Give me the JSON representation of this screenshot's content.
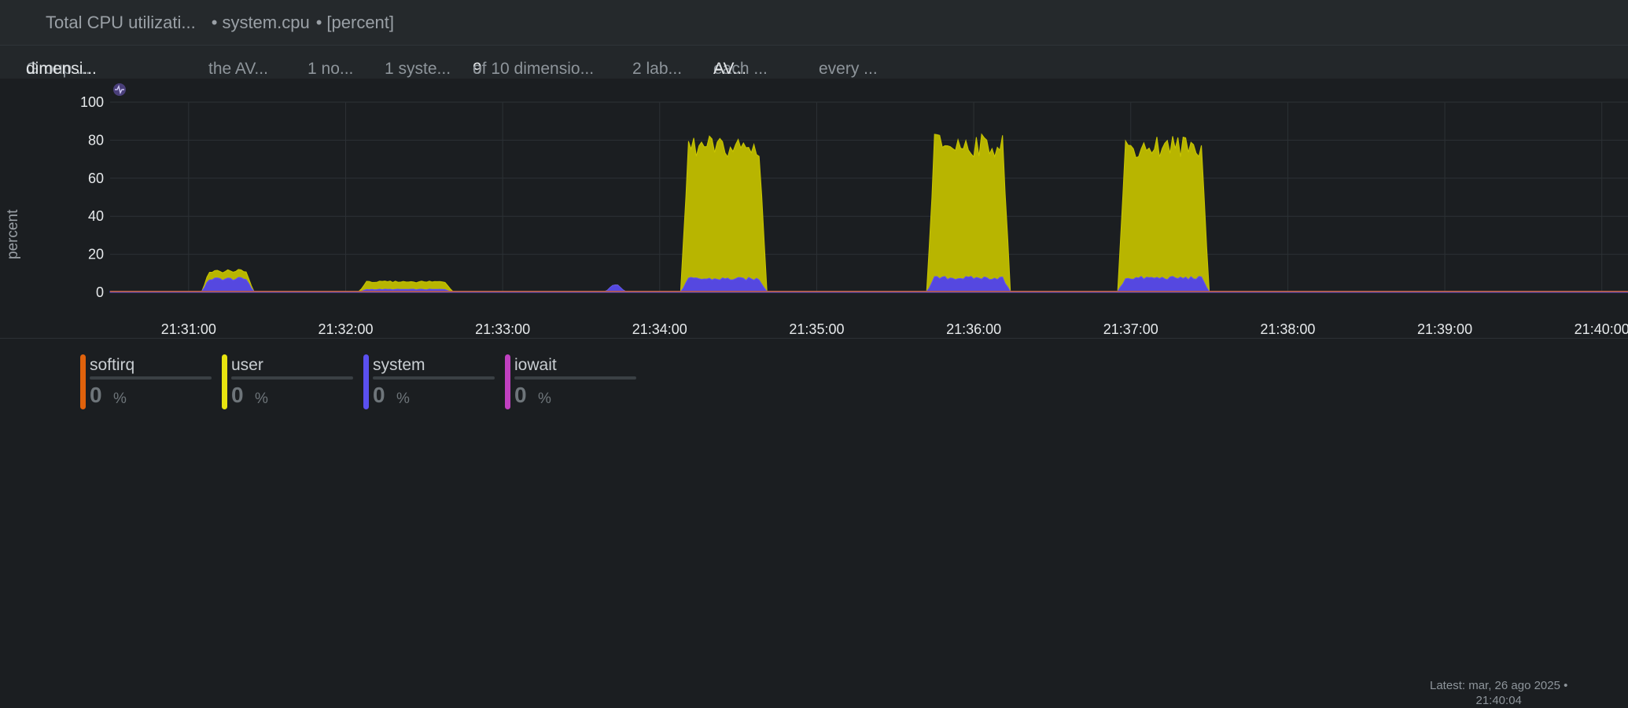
{
  "title": {
    "name": "Total CPU utilizati...",
    "context": "system.cpu",
    "units": "[percent]"
  },
  "filters": [
    {
      "label": "Group ...",
      "value": "dimensi..."
    },
    {
      "label": "the AV...",
      "value": ""
    },
    {
      "label": "1 no...",
      "value": ""
    },
    {
      "label": "1 syste...",
      "value": ""
    },
    {
      "label": "9",
      "value": "of 10 dimensio..."
    },
    {
      "label": "2 lab...",
      "value": ""
    },
    {
      "label": "each ...",
      "value": "AV..."
    },
    {
      "label": "every ...",
      "value": ""
    }
  ],
  "chart_data": {
    "type": "area",
    "stacked": true,
    "ylabel": "percent",
    "ylim": [
      0,
      100
    ],
    "yticks": [
      0,
      20,
      40,
      60,
      80,
      100
    ],
    "grid": true,
    "xtick_labels": [
      "21:31:00",
      "21:32:00",
      "21:33:00",
      "21:34:00",
      "21:35:00",
      "21:36:00",
      "21:37:00",
      "21:38:00",
      "21:39:00",
      "21:40:00"
    ],
    "x_seconds_range": [
      1830,
      2410
    ],
    "colors": {
      "softirq": "#e0620c",
      "user": "#b8b500",
      "system": "#5548e0",
      "iowait": "#c040c0"
    },
    "series": [
      {
        "name": "softirq",
        "type": "flat",
        "value": 0
      },
      {
        "name": "iowait",
        "type": "flat",
        "value": 0
      },
      {
        "name": "system",
        "type": "segments",
        "base": 0.5,
        "segments": [
          {
            "start": 1868,
            "end": 1882,
            "level": 7
          },
          {
            "start": 1928,
            "end": 1958,
            "level": 1.5
          },
          {
            "start": 2022,
            "end": 2024,
            "level": 3.5
          },
          {
            "start": 2051,
            "end": 2078,
            "level": 7
          },
          {
            "start": 2145,
            "end": 2171,
            "level": 7.5
          },
          {
            "start": 2218,
            "end": 2247,
            "level": 7.5
          }
        ]
      },
      {
        "name": "user",
        "type": "segments",
        "base": 0,
        "segments": [
          {
            "start": 1868,
            "end": 1882,
            "level": 4
          },
          {
            "start": 1928,
            "end": 1958,
            "level": 4
          },
          {
            "start": 2051,
            "end": 2078,
            "level": 69
          },
          {
            "start": 2145,
            "end": 2171,
            "level": 70
          },
          {
            "start": 2218,
            "end": 2247,
            "level": 69
          }
        ]
      }
    ]
  },
  "legend": [
    {
      "name": "softirq",
      "value": "0",
      "unit": "%",
      "color": "#e0620c"
    },
    {
      "name": "user",
      "value": "0",
      "unit": "%",
      "color": "#e8e410"
    },
    {
      "name": "system",
      "value": "0",
      "unit": "%",
      "color": "#5a50f0"
    },
    {
      "name": "iowait",
      "value": "0",
      "unit": "%",
      "color": "#c040c0"
    }
  ],
  "latest": {
    "line1": "Latest:  mar, 26 ago 2025 •",
    "line2": "21:40:04"
  }
}
